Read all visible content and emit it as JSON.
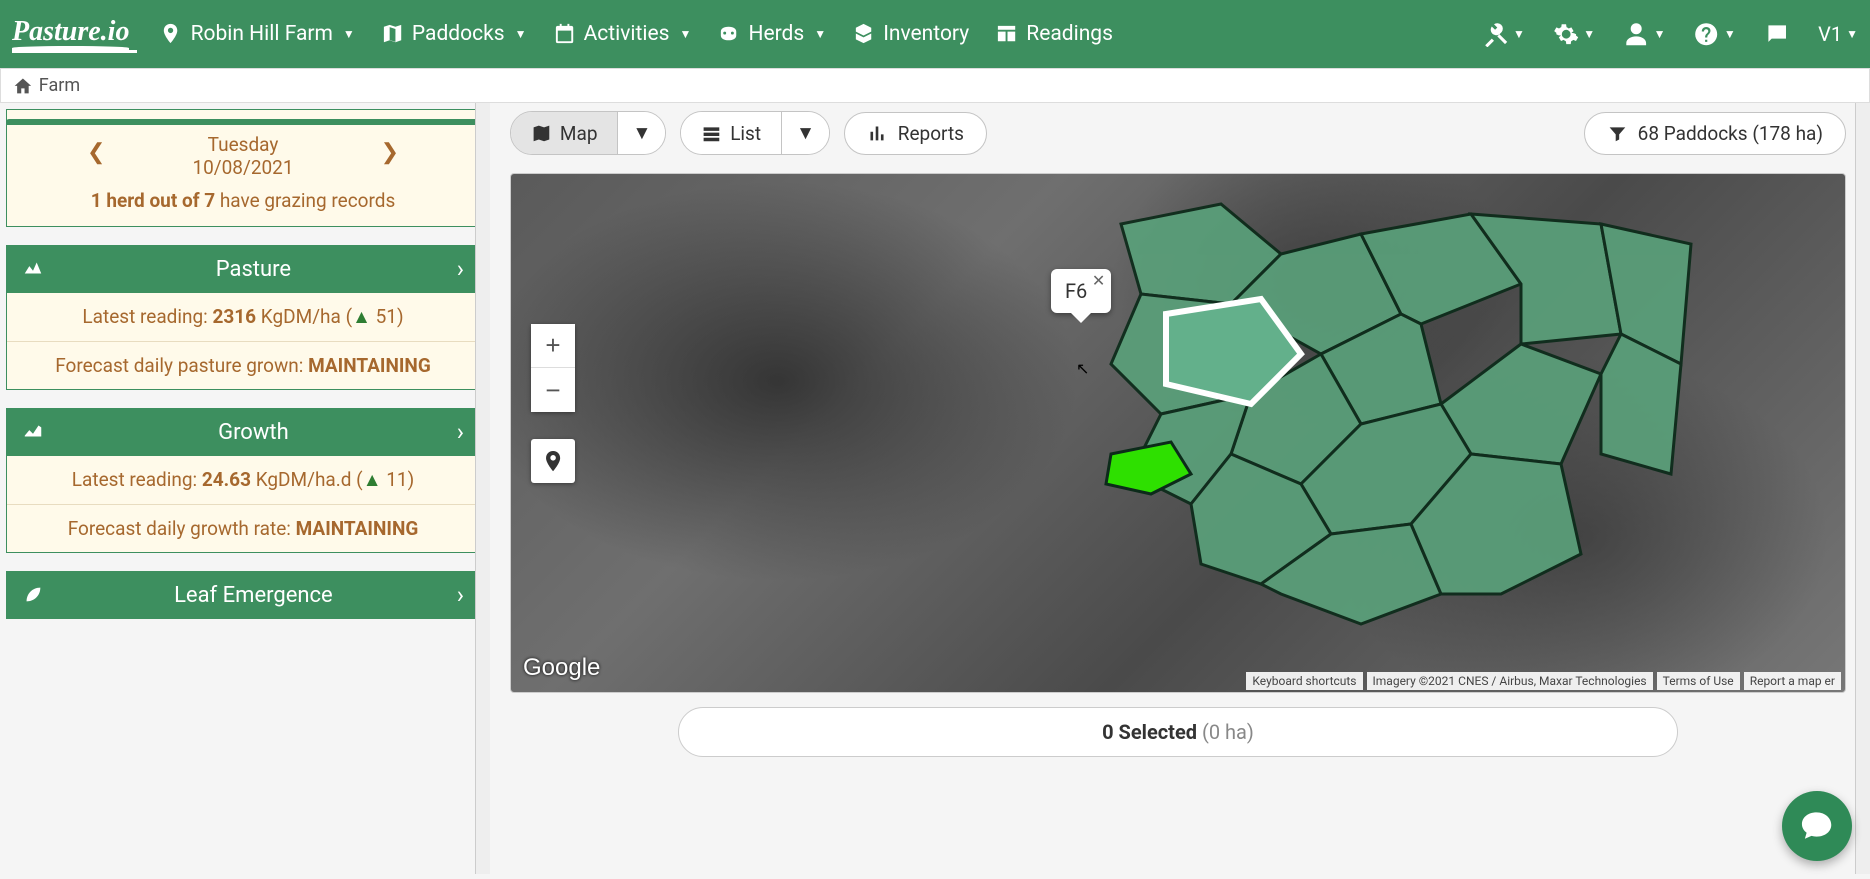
{
  "brand": "Pasture.io",
  "nav": {
    "farm": "Robin Hill Farm",
    "paddocks": "Paddocks",
    "activities": "Activities",
    "herds": "Herds",
    "inventory": "Inventory",
    "readings": "Readings",
    "version": "V1"
  },
  "breadcrumb": "Farm",
  "date_card": {
    "day": "Tuesday",
    "date": "10/08/2021",
    "grazing_prefix": "1 herd out of 7",
    "grazing_suffix": " have grazing records"
  },
  "panels": {
    "pasture": {
      "title": "Pasture",
      "row1_label": "Latest reading: ",
      "row1_value": "2316",
      "row1_unit": " KgDM/ha (",
      "row1_delta": "51",
      "row1_close": ")",
      "row2_label": "Forecast daily pasture grown: ",
      "row2_value": "MAINTAINING"
    },
    "growth": {
      "title": "Growth",
      "row1_label": "Latest reading: ",
      "row1_value": "24.63",
      "row1_unit": " KgDM/ha.d (",
      "row1_delta": "11",
      "row1_close": ")",
      "row2_label": "Forecast daily growth rate: ",
      "row2_value": "MAINTAINING"
    },
    "leaf": {
      "title": "Leaf Emergence"
    }
  },
  "toolbar": {
    "map": "Map",
    "list": "List",
    "reports": "Reports",
    "filter_text": "68 Paddocks (178 ha)"
  },
  "map": {
    "popup_label": "F6",
    "google": "Google",
    "footer1": "Keyboard shortcuts",
    "footer2": "Imagery ©2021 CNES / Airbus, Maxar Technologies",
    "footer3": "Terms of Use",
    "footer4": "Report a map er"
  },
  "selection": {
    "count_text": "0 Selected ",
    "area_text": "(0 ha)"
  }
}
